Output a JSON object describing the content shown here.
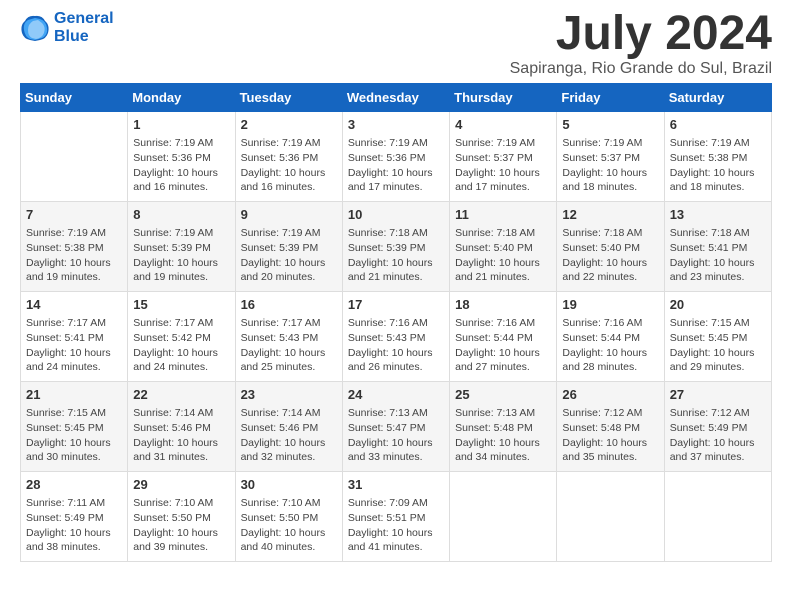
{
  "header": {
    "logo": {
      "line1": "General",
      "line2": "Blue"
    },
    "month": "July 2024",
    "location": "Sapiranga, Rio Grande do Sul, Brazil"
  },
  "columns": [
    "Sunday",
    "Monday",
    "Tuesday",
    "Wednesday",
    "Thursday",
    "Friday",
    "Saturday"
  ],
  "weeks": [
    [
      {
        "day": "",
        "info": ""
      },
      {
        "day": "1",
        "info": "Sunrise: 7:19 AM\nSunset: 5:36 PM\nDaylight: 10 hours\nand 16 minutes."
      },
      {
        "day": "2",
        "info": "Sunrise: 7:19 AM\nSunset: 5:36 PM\nDaylight: 10 hours\nand 16 minutes."
      },
      {
        "day": "3",
        "info": "Sunrise: 7:19 AM\nSunset: 5:36 PM\nDaylight: 10 hours\nand 17 minutes."
      },
      {
        "day": "4",
        "info": "Sunrise: 7:19 AM\nSunset: 5:37 PM\nDaylight: 10 hours\nand 17 minutes."
      },
      {
        "day": "5",
        "info": "Sunrise: 7:19 AM\nSunset: 5:37 PM\nDaylight: 10 hours\nand 18 minutes."
      },
      {
        "day": "6",
        "info": "Sunrise: 7:19 AM\nSunset: 5:38 PM\nDaylight: 10 hours\nand 18 minutes."
      }
    ],
    [
      {
        "day": "7",
        "info": "Sunrise: 7:19 AM\nSunset: 5:38 PM\nDaylight: 10 hours\nand 19 minutes."
      },
      {
        "day": "8",
        "info": "Sunrise: 7:19 AM\nSunset: 5:39 PM\nDaylight: 10 hours\nand 19 minutes."
      },
      {
        "day": "9",
        "info": "Sunrise: 7:19 AM\nSunset: 5:39 PM\nDaylight: 10 hours\nand 20 minutes."
      },
      {
        "day": "10",
        "info": "Sunrise: 7:18 AM\nSunset: 5:39 PM\nDaylight: 10 hours\nand 21 minutes."
      },
      {
        "day": "11",
        "info": "Sunrise: 7:18 AM\nSunset: 5:40 PM\nDaylight: 10 hours\nand 21 minutes."
      },
      {
        "day": "12",
        "info": "Sunrise: 7:18 AM\nSunset: 5:40 PM\nDaylight: 10 hours\nand 22 minutes."
      },
      {
        "day": "13",
        "info": "Sunrise: 7:18 AM\nSunset: 5:41 PM\nDaylight: 10 hours\nand 23 minutes."
      }
    ],
    [
      {
        "day": "14",
        "info": "Sunrise: 7:17 AM\nSunset: 5:41 PM\nDaylight: 10 hours\nand 24 minutes."
      },
      {
        "day": "15",
        "info": "Sunrise: 7:17 AM\nSunset: 5:42 PM\nDaylight: 10 hours\nand 24 minutes."
      },
      {
        "day": "16",
        "info": "Sunrise: 7:17 AM\nSunset: 5:43 PM\nDaylight: 10 hours\nand 25 minutes."
      },
      {
        "day": "17",
        "info": "Sunrise: 7:16 AM\nSunset: 5:43 PM\nDaylight: 10 hours\nand 26 minutes."
      },
      {
        "day": "18",
        "info": "Sunrise: 7:16 AM\nSunset: 5:44 PM\nDaylight: 10 hours\nand 27 minutes."
      },
      {
        "day": "19",
        "info": "Sunrise: 7:16 AM\nSunset: 5:44 PM\nDaylight: 10 hours\nand 28 minutes."
      },
      {
        "day": "20",
        "info": "Sunrise: 7:15 AM\nSunset: 5:45 PM\nDaylight: 10 hours\nand 29 minutes."
      }
    ],
    [
      {
        "day": "21",
        "info": "Sunrise: 7:15 AM\nSunset: 5:45 PM\nDaylight: 10 hours\nand 30 minutes."
      },
      {
        "day": "22",
        "info": "Sunrise: 7:14 AM\nSunset: 5:46 PM\nDaylight: 10 hours\nand 31 minutes."
      },
      {
        "day": "23",
        "info": "Sunrise: 7:14 AM\nSunset: 5:46 PM\nDaylight: 10 hours\nand 32 minutes."
      },
      {
        "day": "24",
        "info": "Sunrise: 7:13 AM\nSunset: 5:47 PM\nDaylight: 10 hours\nand 33 minutes."
      },
      {
        "day": "25",
        "info": "Sunrise: 7:13 AM\nSunset: 5:48 PM\nDaylight: 10 hours\nand 34 minutes."
      },
      {
        "day": "26",
        "info": "Sunrise: 7:12 AM\nSunset: 5:48 PM\nDaylight: 10 hours\nand 35 minutes."
      },
      {
        "day": "27",
        "info": "Sunrise: 7:12 AM\nSunset: 5:49 PM\nDaylight: 10 hours\nand 37 minutes."
      }
    ],
    [
      {
        "day": "28",
        "info": "Sunrise: 7:11 AM\nSunset: 5:49 PM\nDaylight: 10 hours\nand 38 minutes."
      },
      {
        "day": "29",
        "info": "Sunrise: 7:10 AM\nSunset: 5:50 PM\nDaylight: 10 hours\nand 39 minutes."
      },
      {
        "day": "30",
        "info": "Sunrise: 7:10 AM\nSunset: 5:50 PM\nDaylight: 10 hours\nand 40 minutes."
      },
      {
        "day": "31",
        "info": "Sunrise: 7:09 AM\nSunset: 5:51 PM\nDaylight: 10 hours\nand 41 minutes."
      },
      {
        "day": "",
        "info": ""
      },
      {
        "day": "",
        "info": ""
      },
      {
        "day": "",
        "info": ""
      }
    ]
  ]
}
